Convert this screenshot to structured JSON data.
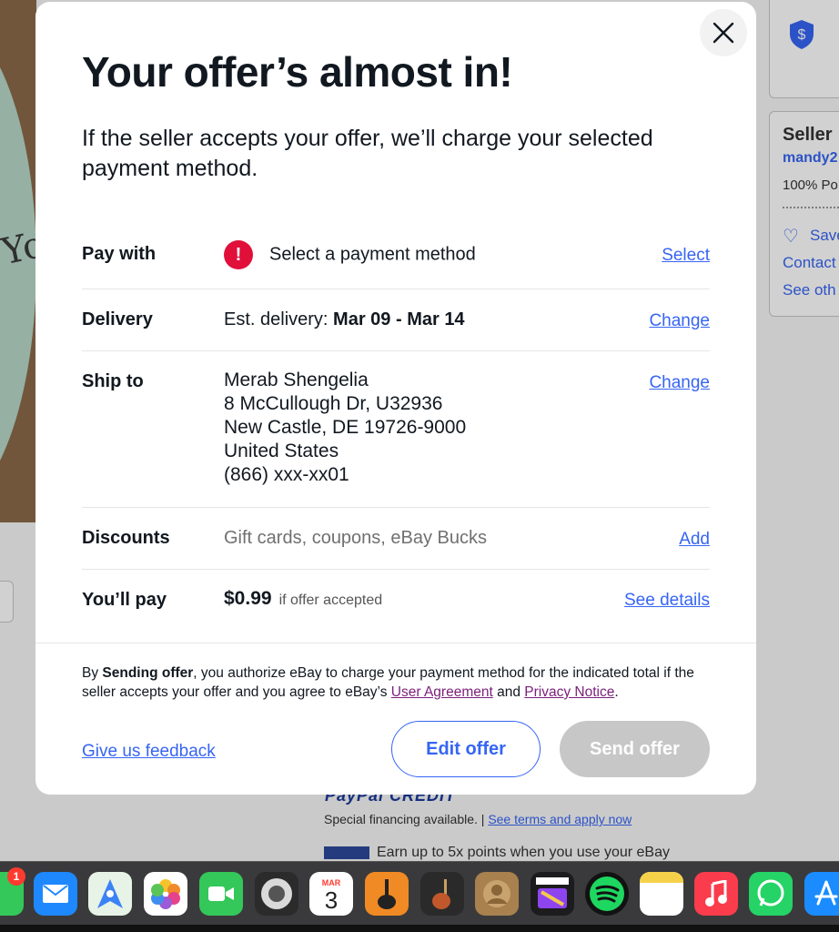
{
  "background": {
    "seller_title": "Seller",
    "seller_name": "mandy2",
    "seller_positive": "100% Po",
    "save_label": "Save",
    "contact_label": "Contact",
    "see_other_label": "See oth",
    "paypal_logo": "PayPal CREDIT",
    "financing_text": "Special financing available. |",
    "financing_link": "See terms and apply now",
    "earn_text": "Earn up to 5x points when you use your eBay"
  },
  "modal": {
    "title": "Your offer’s almost in!",
    "subtitle": "If the seller accepts your offer, we’ll charge your selected payment method.",
    "pay_with": {
      "label": "Pay with",
      "value": "Select a payment method",
      "alert_glyph": "!",
      "action": "Select"
    },
    "delivery": {
      "label": "Delivery",
      "prefix": "Est. delivery: ",
      "dates": "Mar 09 - Mar 14",
      "action": "Change"
    },
    "ship_to": {
      "label": "Ship to",
      "lines": [
        "Merab Shengelia",
        "8 McCullough Dr, U32936",
        "New Castle, DE 19726-9000",
        "United States",
        "(866) xxx-xx01"
      ],
      "action": "Change"
    },
    "discounts": {
      "label": "Discounts",
      "value": "Gift cards, coupons, eBay Bucks",
      "action": "Add"
    },
    "you_pay": {
      "label": "You’ll pay",
      "amount": "$0.99",
      "note": "if offer accepted",
      "action": "See details"
    },
    "legal": {
      "prefix": "By ",
      "bold": "Sending offer",
      "middle": ", you authorize eBay to charge your payment method for the indicated total if the seller accepts your offer and you agree to eBay’s ",
      "user_agreement": "User Agreement",
      "and": " and ",
      "privacy_notice": "Privacy Notice",
      "end": "."
    },
    "feedback_link": "Give us feedback",
    "edit_button": "Edit offer",
    "send_button": "Send offer"
  },
  "dock": {
    "badge_count": "1",
    "calendar_month": "MAR",
    "calendar_day": "3",
    "apps": [
      "messages-icon",
      "mail-icon",
      "maps-icon",
      "photos-icon",
      "facetime-icon",
      "logic-icon",
      "calendar-icon",
      "garageband-icon",
      "garageband-2-icon",
      "contacts-icon",
      "final-cut-icon",
      "spotify-icon",
      "notes-icon",
      "music-icon",
      "whatsapp-icon",
      "app-store-icon"
    ]
  },
  "colors": {
    "link": "#3665f3",
    "alert": "#e0103a",
    "disabled_button": "#c7c7c7",
    "legal_link": "#7a1f7a"
  }
}
